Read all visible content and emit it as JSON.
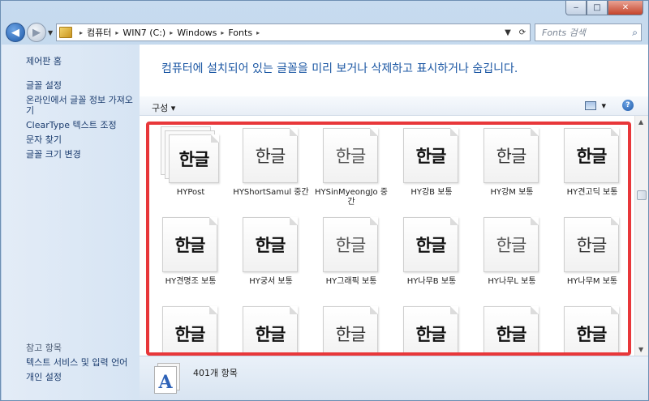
{
  "window": {
    "caption": {
      "minimize": "‒",
      "maximize": "□",
      "close": "✕"
    }
  },
  "nav": {
    "back_icon": "back-arrow-icon",
    "forward_icon": "forward-arrow-icon",
    "breadcrumbs": [
      "컴퓨터",
      "WIN7 (C:)",
      "Windows",
      "Fonts"
    ],
    "search_placeholder": "Fonts 검색"
  },
  "sidebar": {
    "home": "제어판 홈",
    "links": [
      "글꼴 설정",
      "온라인에서 글꼴 정보 가져오기",
      "ClearType 텍스트 조정",
      "문자 찾기",
      "글꼴 크기 변경"
    ],
    "see_also": "참고 항목",
    "bottom_links": [
      "텍스트 서비스 및 입력 언어",
      "개인 설정"
    ]
  },
  "main": {
    "headline": "컴퓨터에 설치되어 있는 글꼴을 미리 보거나 삭제하고 표시하거나 숨깁니다.",
    "organize_label": "구성 ▾",
    "help_label": "?"
  },
  "fonts": [
    {
      "preview": "한글",
      "style": "bold",
      "name": "HYPost",
      "stacked": true
    },
    {
      "preview": "한글",
      "style": "thin",
      "name": "HYShortSamul 중간",
      "stacked": false
    },
    {
      "preview": "한글",
      "style": "light",
      "name": "HYSinMyeongJo 중간",
      "stacked": false
    },
    {
      "preview": "한글",
      "style": "bold",
      "name": "HY강B 보통",
      "stacked": false
    },
    {
      "preview": "한글",
      "style": "thin",
      "name": "HY강M 보통",
      "stacked": false
    },
    {
      "preview": "한글",
      "style": "bold",
      "name": "HY견고딕 보통",
      "stacked": false
    },
    {
      "preview": "한글",
      "style": "serif",
      "name": "HY견명조 보통",
      "stacked": false
    },
    {
      "preview": "한글",
      "style": "serif",
      "name": "HY궁서 보통",
      "stacked": false
    },
    {
      "preview": "한글",
      "style": "light",
      "name": "HY그래픽 보통",
      "stacked": false
    },
    {
      "preview": "한글",
      "style": "bold",
      "name": "HY나무B 보통",
      "stacked": false
    },
    {
      "preview": "한글",
      "style": "light",
      "name": "HY나무L 보통",
      "stacked": false
    },
    {
      "preview": "한글",
      "style": "thin",
      "name": "HY나무M 보통",
      "stacked": false
    },
    {
      "preview": "한글",
      "style": "bold",
      "name": "",
      "stacked": false
    },
    {
      "preview": "한글",
      "style": "bold",
      "name": "",
      "stacked": false
    },
    {
      "preview": "한글",
      "style": "thin",
      "name": "",
      "stacked": false
    },
    {
      "preview": "한글",
      "style": "serif",
      "name": "",
      "stacked": false
    },
    {
      "preview": "한글",
      "style": "serif",
      "name": "",
      "stacked": false
    },
    {
      "preview": "한글",
      "style": "serif",
      "name": "",
      "stacked": false
    }
  ],
  "status": {
    "item_count": "401개 항목"
  }
}
